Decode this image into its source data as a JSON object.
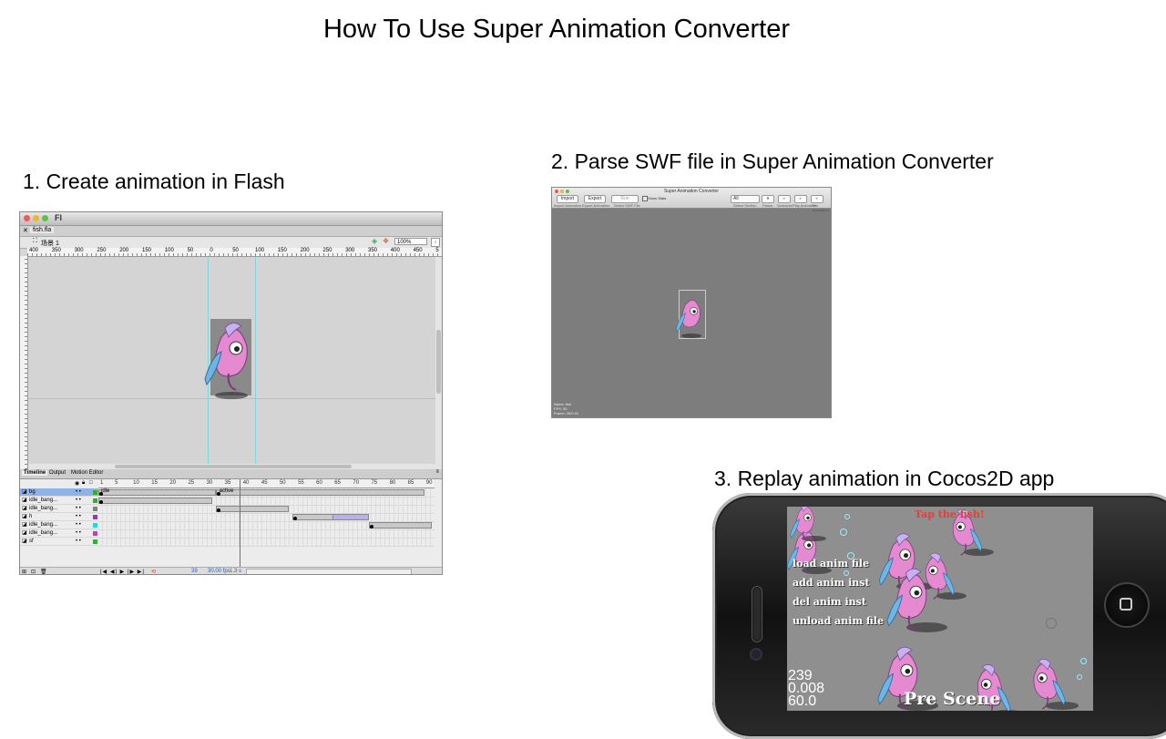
{
  "page": {
    "title": "How To Use Super Animation Converter"
  },
  "steps": {
    "s1": "1. Create animation in Flash",
    "s2": "2. Parse SWF file in Super Animation Converter",
    "s3": "3. Replay animation in Cocos2D app"
  },
  "flash": {
    "app_label": "Fl",
    "doc_tab": "fish.fla",
    "scene": "场景 1",
    "zoom": "100%",
    "ruler_labels": [
      "400",
      "350",
      "300",
      "250",
      "200",
      "150",
      "100",
      "50",
      "0",
      "50",
      "100",
      "150",
      "200",
      "250",
      "300",
      "350",
      "400",
      "450",
      "5"
    ],
    "panel_tabs": [
      "Timeline",
      "Output",
      "Motion Editor"
    ],
    "frame_numbers": [
      "1",
      "5",
      "10",
      "15",
      "20",
      "25",
      "30",
      "35",
      "40",
      "45",
      "50",
      "55",
      "60",
      "65",
      "70",
      "75",
      "80",
      "85",
      "90"
    ],
    "layers": [
      {
        "name": "bg",
        "color": "#3aa83a",
        "label": "idle",
        "label2": "active"
      },
      {
        "name": "idle_bang...",
        "color": "#3aa83a"
      },
      {
        "name": "idle_bang...",
        "color": "#808080"
      },
      {
        "name": "h",
        "color": "#9a3ab0"
      },
      {
        "name": "idle_bang...",
        "color": "#3ad0d0"
      },
      {
        "name": "idle_bang...",
        "color": "#c040c0"
      },
      {
        "name": "sf",
        "color": "#3aa83a"
      }
    ],
    "status": {
      "frame": "39",
      "fps": "30.00 fps",
      "time": "1.3 s"
    },
    "current_frame": 39
  },
  "sac": {
    "window_title": "Super Animation Converter",
    "buttons": {
      "import": "Import",
      "export": "Export",
      "run": "Run"
    },
    "show_stats": "Show Stats",
    "select_all": "All",
    "toolbar_labels": [
      "Import Animation",
      "Export Animation",
      "Select SWF File",
      "Select Section",
      "Pause",
      "Schedule",
      "Play Animation",
      "Per Animation"
    ],
    "info_lines": [
      "Name: fish",
      "FPS: 30",
      "Frame: 39/0.01"
    ]
  },
  "phone": {
    "tap_text": "Tap the fish!",
    "menu": [
      "load anim file",
      "add anim inst",
      "del anim inst",
      "unload anim file"
    ],
    "stats": [
      "239",
      "0.008",
      "60.0"
    ],
    "pre_scene": "Pre Scene"
  },
  "colors": {
    "stage_grey": "#d4d4d4",
    "sac_bg": "#7d7d7d",
    "guide": "#7fd6dc",
    "fish_pink": "#e58ad0",
    "fish_stripe": "#6bb7e8"
  }
}
